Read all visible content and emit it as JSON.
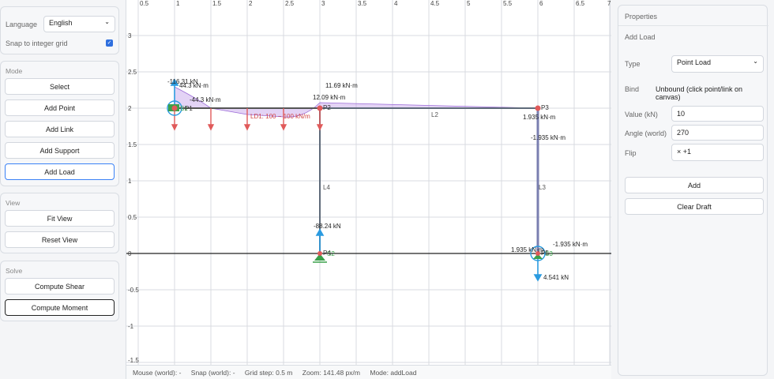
{
  "settings": {
    "language_label": "Language",
    "language_value": "English",
    "snap_label": "Snap to integer grid",
    "snap_checked": true
  },
  "mode": {
    "title": "Mode",
    "buttons": [
      "Select",
      "Add Point",
      "Add Link",
      "Add Support",
      "Add Load"
    ],
    "active": "Add Load"
  },
  "view": {
    "title": "View",
    "buttons": [
      "Fit View",
      "Reset View"
    ]
  },
  "solve": {
    "title": "Solve",
    "buttons": [
      "Compute Shear",
      "Compute Moment"
    ],
    "active": "Compute Moment"
  },
  "canvas": {
    "x_ticks": [
      "0.5",
      "1",
      "1.5",
      "2",
      "2.5",
      "3",
      "3.5",
      "4",
      "4.5",
      "5",
      "5.5",
      "6",
      "6.5",
      "7"
    ],
    "y_ticks": [
      "3",
      "2.5",
      "2",
      "1.5",
      "1",
      "0.5",
      "0",
      "-0.5",
      "-1",
      "-1.5"
    ],
    "points": [
      "P1",
      "P2",
      "P3",
      "P4",
      "P5"
    ],
    "links": [
      "L2",
      "L3",
      "L4"
    ],
    "supports": [
      "S1",
      "S2",
      "S3"
    ],
    "load_label": "LD1: 100 − 100 kN/m",
    "annotations": {
      "a1": "-116.31 kN",
      "a2": "44.3 kN·m",
      "a3": "-44.3 kN·m",
      "a4": "11.69 kN·m",
      "a5": "12.09 kN·m",
      "a6": "1.935 kN·m",
      "a7": "-1.935 kN·m",
      "a8": "-88.24 kN",
      "a9": "1.935 kN·m",
      "a10": "-1.935 kN·m",
      "a11": "4.541 kN"
    }
  },
  "status": {
    "mouse": "Mouse (world): -",
    "snap": "Snap (world): -",
    "grid": "Grid step: 0.5 m",
    "zoom": "Zoom: 141.48 px/m",
    "mode": "Mode: addLoad"
  },
  "properties": {
    "title": "Properties",
    "subtitle": "Add Load",
    "type_label": "Type",
    "type_value": "Point Load",
    "bind_label": "Bind",
    "bind_value": "Unbound (click point/link on canvas)",
    "value_label": "Value (kN)",
    "value": "10",
    "angle_label": "Angle (world)",
    "angle": "270",
    "flip_label": "Flip",
    "flip_value": "× +1",
    "add_button": "Add",
    "clear_button": "Clear Draft"
  },
  "colors": {
    "accent": "#3b82f6",
    "load_arrow": "#e05a5a",
    "reaction_arrow": "#2b9be0",
    "moment_fill": "#b58be6",
    "support_green": "#3aa04a"
  }
}
